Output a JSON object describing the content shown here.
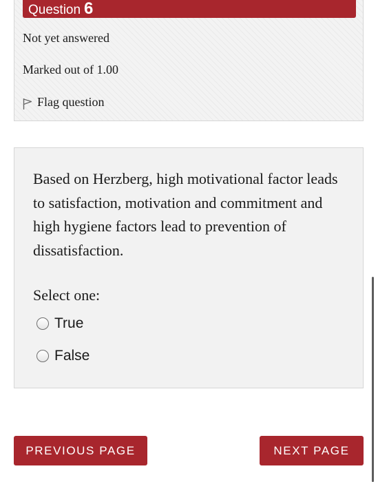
{
  "question_info": {
    "prefix": "Question",
    "number": "6",
    "status": "Not yet answered",
    "marks": "Marked out of 1.00",
    "flag_label": "Flag question"
  },
  "question": {
    "text": "Based on Herzberg, high motivational factor leads to satisfaction, motivation and commitment and high hygiene factors lead to prevention of dissatisfaction.",
    "prompt": "Select one:",
    "options": [
      {
        "label": "True",
        "selected": false
      },
      {
        "label": "False",
        "selected": false
      }
    ]
  },
  "navigation": {
    "previous_label": "PREVIOUS PAGE",
    "next_label": "NEXT PAGE"
  },
  "colors": {
    "accent": "#a8262d",
    "panel_background": "#f2f2f2",
    "panel_border": "#d6d6d6"
  },
  "icons": {
    "flag": "flag-icon",
    "radio": "radio-button-icon"
  }
}
